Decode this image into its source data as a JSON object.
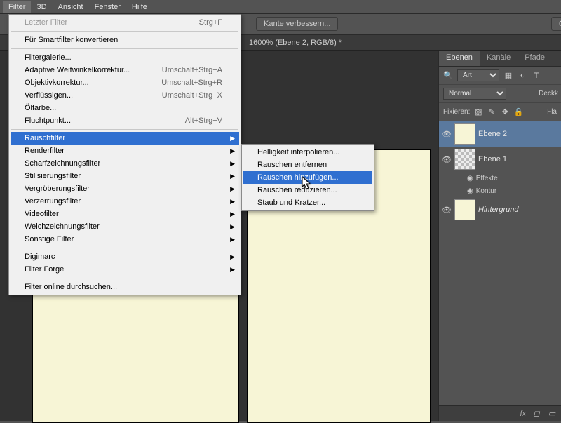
{
  "menubar": {
    "items": [
      "Filter",
      "3D",
      "Ansicht",
      "Fenster",
      "Hilfe"
    ],
    "active_index": 0
  },
  "toolbar": {
    "kante_label": "Kante verbessern...",
    "gruppe_label": "Gru"
  },
  "doc_tab": {
    "label": "1600% (Ebene 2, RGB/8) *"
  },
  "filter_menu": {
    "last": {
      "label": "Letzter Filter",
      "shortcut": "Strg+F"
    },
    "smart": {
      "label": "Für Smartfilter konvertieren"
    },
    "gallery": {
      "label": "Filtergalerie..."
    },
    "adaptive": {
      "label": "Adaptive Weitwinkelkorrektur...",
      "shortcut": "Umschalt+Strg+A"
    },
    "lens": {
      "label": "Objektivkorrektur...",
      "shortcut": "Umschalt+Strg+R"
    },
    "liquify": {
      "label": "Verflüssigen...",
      "shortcut": "Umschalt+Strg+X"
    },
    "oil": {
      "label": "Ölfarbe..."
    },
    "vanish": {
      "label": "Fluchtpunkt...",
      "shortcut": "Alt+Strg+V"
    },
    "noise": {
      "label": "Rauschfilter"
    },
    "render": {
      "label": "Renderfilter"
    },
    "sharpen": {
      "label": "Scharfzeichnungsfilter"
    },
    "stylise": {
      "label": "Stilisierungsfilter"
    },
    "magnify": {
      "label": "Vergröberungsfilter"
    },
    "distort": {
      "label": "Verzerrungsfilter"
    },
    "video": {
      "label": "Videofilter"
    },
    "blur": {
      "label": "Weichzeichnungsfilter"
    },
    "other": {
      "label": "Sonstige Filter"
    },
    "digimarc": {
      "label": "Digimarc"
    },
    "forge": {
      "label": "Filter Forge"
    },
    "online": {
      "label": "Filter online durchsuchen..."
    }
  },
  "noise_submenu": {
    "brightness": {
      "label": "Helligkeit interpolieren..."
    },
    "remove": {
      "label": "Rauschen entfernen"
    },
    "add": {
      "label": "Rauschen hinzufügen..."
    },
    "reduce": {
      "label": "Rauschen reduzieren..."
    },
    "dust": {
      "label": "Staub und Kratzer..."
    }
  },
  "panels": {
    "tabs": [
      "Ebenen",
      "Kanäle",
      "Pfade"
    ],
    "active": 0,
    "filter_select": "Art",
    "blend_select": "Normal",
    "opacity_label": "Deckk",
    "lock_label": "Fixieren:",
    "fill_label": "Flä",
    "layers": [
      {
        "name": "Ebene 2",
        "active": true,
        "thumb": "fill"
      },
      {
        "name": "Ebene 1",
        "active": false,
        "thumb": "checker",
        "effects_label": "Effekte",
        "kontur_label": "Kontur"
      },
      {
        "name": "Hintergrund",
        "active": false,
        "thumb": "fill",
        "italic": true
      }
    ],
    "footer_fx": "fx"
  }
}
